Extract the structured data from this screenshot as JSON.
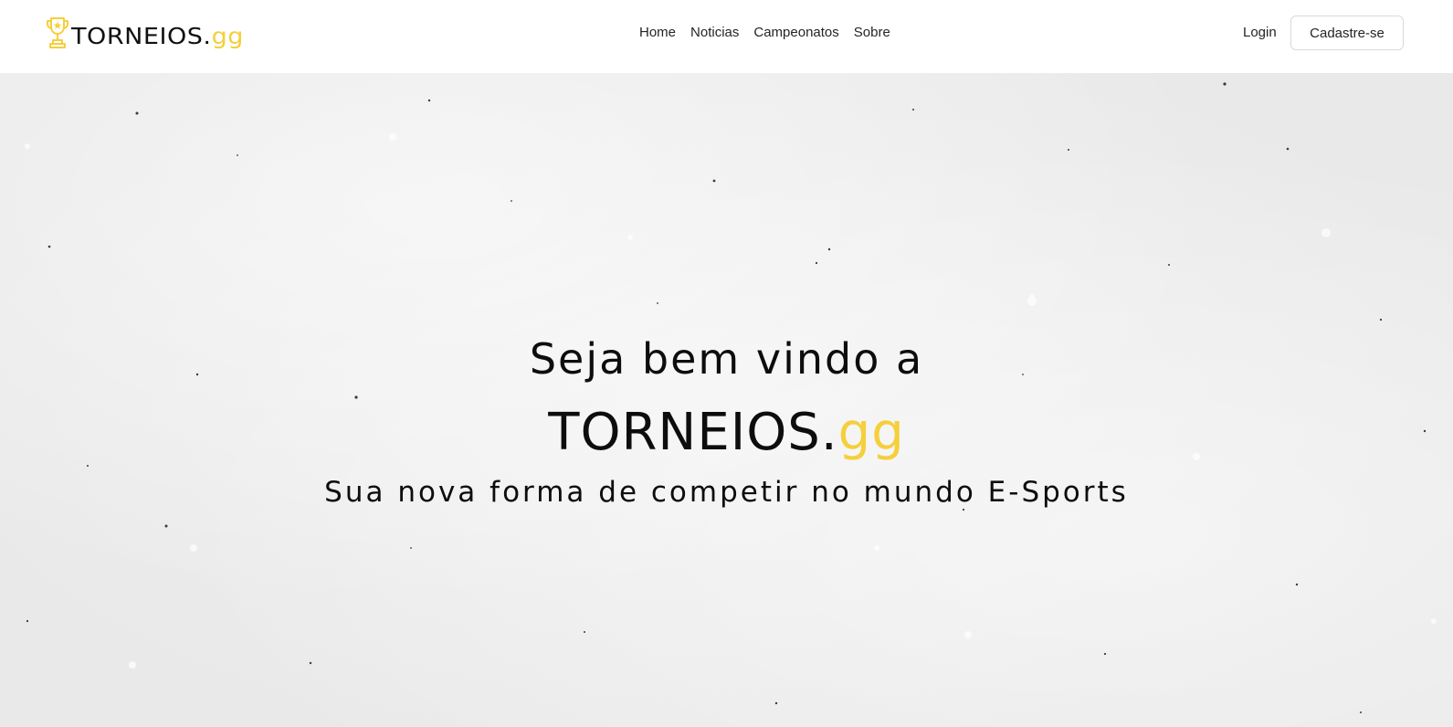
{
  "colors": {
    "accent": "#f5cf3c",
    "text": "#0d0d0d",
    "nav_bg": "#ffffff",
    "hero_bg": "#ececec"
  },
  "navbar": {
    "brand": {
      "icon": "trophy-icon",
      "name": "TORNEIOS.",
      "suffix": "gg"
    },
    "links": [
      "Home",
      "Noticias",
      "Campeonatos",
      "Sobre"
    ],
    "login_label": "Login",
    "signup_label": "Cadastre-se"
  },
  "hero": {
    "welcome": "Seja bem vindo a",
    "brand_name": "TORNEIOS.",
    "brand_suffix": "gg",
    "tagline": "Sua nova forma de competir no mundo E-Sports"
  }
}
